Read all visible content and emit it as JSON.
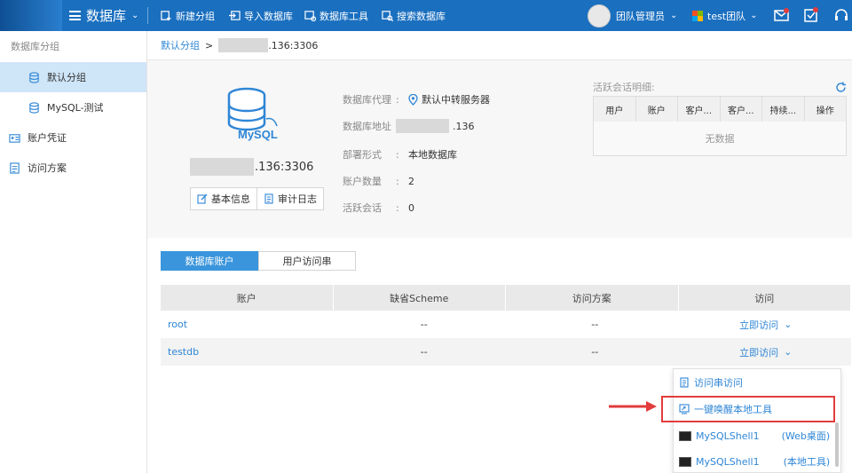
{
  "topbar": {
    "app_title": "数据库",
    "nav": [
      {
        "label": "新建分组",
        "icon": "add-group-icon"
      },
      {
        "label": "导入数据库",
        "icon": "import-icon"
      },
      {
        "label": "数据库工具",
        "icon": "database-tools-icon"
      },
      {
        "label": "搜索数据库",
        "icon": "search-database-icon"
      }
    ],
    "user_label": "团队管理员",
    "team_label": "test团队"
  },
  "sidebar": {
    "header": "数据库分组",
    "items": [
      {
        "label": "默认分组",
        "icon": "database-icon",
        "active": true
      },
      {
        "label": "MySQL-测试",
        "icon": "database-icon",
        "active": false
      },
      {
        "label": "账户凭证",
        "icon": "credential-icon",
        "active": false
      },
      {
        "label": "访问方案",
        "icon": "document-icon",
        "active": false
      }
    ]
  },
  "breadcrumb": {
    "group_link": "默认分组",
    "separator": ">",
    "host_suffix": ".136:3306"
  },
  "database": {
    "host_suffix": ".136:3306",
    "buttons": {
      "basic_info": "基本信息",
      "audit_log": "审计日志"
    },
    "fields": {
      "proxy_label": "数据库代理",
      "proxy_value": "默认中转服务器",
      "address_label": "数据库地址",
      "address_suffix": ".136",
      "deploy_label": "部署形式",
      "deploy_value": "本地数据库",
      "accounts_label": "账户数量",
      "accounts_value": "2",
      "sessions_label": "活跃会话",
      "sessions_value": "0",
      "colon": ":"
    }
  },
  "session_detail": {
    "title": "活跃会话明细:",
    "columns": [
      "用户",
      "账户",
      "客户...",
      "客户...",
      "持续...",
      "操作"
    ],
    "empty": "无数据"
  },
  "tabs": [
    "数据库账户",
    "用户访问串"
  ],
  "accounts_table": {
    "columns": [
      "账户",
      "缺省Scheme",
      "访问方案",
      "访问"
    ],
    "rows": [
      {
        "account": "root",
        "scheme": "--",
        "plan": "--",
        "access": "立即访问"
      },
      {
        "account": "testdb",
        "scheme": "--",
        "plan": "--",
        "access": "立即访问"
      }
    ]
  },
  "access_menu": {
    "items": [
      {
        "label": "访问串访问",
        "icon": "document-icon"
      },
      {
        "label": "一键唤醒本地工具",
        "icon": "launch-icon",
        "highlighted": true
      },
      {
        "label": "MySQLShell1",
        "suffix": "(Web桌面)",
        "icon": "terminal-icon"
      },
      {
        "label": "MySQLShell1",
        "suffix": "(本地工具)",
        "icon": "terminal-icon"
      }
    ]
  },
  "colors": {
    "topbar": "#1a6fbf",
    "accent": "#3a95dc",
    "link": "#2f86d6",
    "highlight": "#e23c3c"
  }
}
